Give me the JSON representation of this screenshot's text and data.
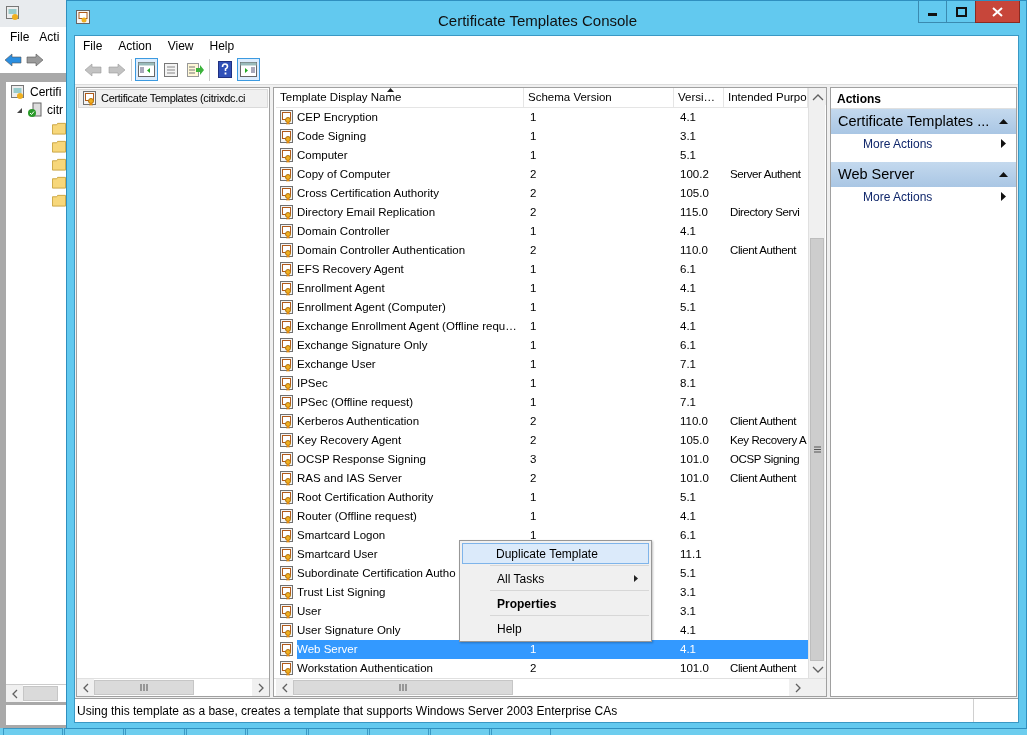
{
  "background_window": {
    "menu": [
      "File",
      "Acti"
    ],
    "toolbar": [
      {
        "kind": "back",
        "disabled": false
      },
      {
        "kind": "forward",
        "disabled": true
      }
    ],
    "tree": [
      {
        "label": "Certifi",
        "children": [
          {
            "label": "citr",
            "expanded": true,
            "children": [
              {
                "kind": "folder"
              },
              {
                "kind": "folder"
              },
              {
                "kind": "folder"
              },
              {
                "kind": "folder"
              },
              {
                "kind": "folder"
              }
            ]
          }
        ]
      }
    ]
  },
  "window": {
    "title": "Certificate Templates Console"
  },
  "menu": [
    "File",
    "Action",
    "View",
    "Help"
  ],
  "toolbar": [
    [
      {
        "kind": "back",
        "disabled": true,
        "pressed": false
      },
      {
        "kind": "forward",
        "disabled": true,
        "pressed": false
      }
    ],
    [
      {
        "kind": "tree_toggle",
        "disabled": false,
        "pressed": true
      },
      {
        "kind": "properties",
        "disabled": false,
        "pressed": false
      },
      {
        "kind": "export",
        "disabled": false,
        "pressed": false
      }
    ],
    [
      {
        "kind": "help",
        "disabled": false,
        "pressed": false
      },
      {
        "kind": "action_pane_toggle",
        "disabled": false,
        "pressed": true
      }
    ]
  ],
  "tree": [
    {
      "label": "Certificate Templates (citrixdc.ci",
      "selected": true
    }
  ],
  "list": {
    "columns": [
      {
        "label": "Template Display Name",
        "sorted": true
      },
      {
        "label": "Schema Version",
        "sorted": false
      },
      {
        "label": "Versi…",
        "sorted": false
      },
      {
        "label": "Intended Purpo",
        "sorted": false
      }
    ],
    "rows": [
      {
        "name": "CEP Encryption",
        "schema": "1",
        "version": "4.1",
        "selected": false
      },
      {
        "name": "Code Signing",
        "schema": "1",
        "version": "3.1",
        "selected": false
      },
      {
        "name": "Computer",
        "schema": "1",
        "version": "5.1",
        "selected": false
      },
      {
        "name": "Copy of Computer",
        "schema": "2",
        "version": "100.2",
        "purpose": "Server Authent",
        "selected": false
      },
      {
        "name": "Cross Certification Authority",
        "schema": "2",
        "version": "105.0",
        "selected": false
      },
      {
        "name": "Directory Email Replication",
        "schema": "2",
        "version": "115.0",
        "purpose": "Directory Servi",
        "selected": false
      },
      {
        "name": "Domain Controller",
        "schema": "1",
        "version": "4.1",
        "selected": false
      },
      {
        "name": "Domain Controller Authentication",
        "schema": "2",
        "version": "110.0",
        "purpose": "Client Authent",
        "selected": false
      },
      {
        "name": "EFS Recovery Agent",
        "schema": "1",
        "version": "6.1",
        "selected": false
      },
      {
        "name": "Enrollment Agent",
        "schema": "1",
        "version": "4.1",
        "selected": false
      },
      {
        "name": "Enrollment Agent (Computer)",
        "schema": "1",
        "version": "5.1",
        "selected": false
      },
      {
        "name": "Exchange Enrollment Agent (Offline requ…",
        "schema": "1",
        "version": "4.1",
        "selected": false
      },
      {
        "name": "Exchange Signature Only",
        "schema": "1",
        "version": "6.1",
        "selected": false
      },
      {
        "name": "Exchange User",
        "schema": "1",
        "version": "7.1",
        "selected": false
      },
      {
        "name": "IPSec",
        "schema": "1",
        "version": "8.1",
        "selected": false
      },
      {
        "name": "IPSec (Offline request)",
        "schema": "1",
        "version": "7.1",
        "selected": false
      },
      {
        "name": "Kerberos Authentication",
        "schema": "2",
        "version": "110.0",
        "purpose": "Client Authent",
        "selected": false
      },
      {
        "name": "Key Recovery Agent",
        "schema": "2",
        "version": "105.0",
        "purpose": "Key Recovery A",
        "selected": false
      },
      {
        "name": "OCSP Response Signing",
        "schema": "3",
        "version": "101.0",
        "purpose": "OCSP Signing",
        "selected": false
      },
      {
        "name": "RAS and IAS Server",
        "schema": "2",
        "version": "101.0",
        "purpose": "Client Authent",
        "selected": false
      },
      {
        "name": "Root Certification Authority",
        "schema": "1",
        "version": "5.1",
        "selected": false
      },
      {
        "name": "Router (Offline request)",
        "schema": "1",
        "version": "4.1",
        "selected": false
      },
      {
        "name": "Smartcard Logon",
        "schema": "1",
        "version": "6.1",
        "selected": false
      },
      {
        "name": "Smartcard User",
        "version": "11.1",
        "selected": false
      },
      {
        "name": "Subordinate Certification Autho",
        "version": "5.1",
        "selected": false
      },
      {
        "name": "Trust List Signing",
        "version": "3.1",
        "selected": false
      },
      {
        "name": "User",
        "version": "3.1",
        "selected": false
      },
      {
        "name": "User Signature Only",
        "version": "4.1",
        "selected": false
      },
      {
        "name": "Web Server",
        "schema": "1",
        "version": "4.1",
        "selected": true
      },
      {
        "name": "Workstation Authentication",
        "schema": "2",
        "version": "101.0",
        "purpose": "Client Authent",
        "selected": false
      }
    ]
  },
  "actions": {
    "title": "Actions",
    "sections": [
      {
        "title": "Certificate Templates ...",
        "expanded": true,
        "items": [
          "More Actions"
        ]
      },
      {
        "title": "Web Server",
        "expanded": true,
        "items": [
          "More Actions"
        ]
      }
    ]
  },
  "context_menu": [
    {
      "label": "Duplicate Template",
      "highlighted": true,
      "bold": false,
      "submenu": false
    },
    {
      "label": "All Tasks",
      "highlighted": false,
      "bold": false,
      "submenu": true
    },
    {
      "label": "Properties",
      "highlighted": false,
      "bold": true,
      "submenu": false
    },
    {
      "label": "Help",
      "highlighted": false,
      "bold": false,
      "submenu": false
    }
  ],
  "status_bar": "Using this template as a base, creates a template that supports Windows Server 2003 Enterprise CAs"
}
